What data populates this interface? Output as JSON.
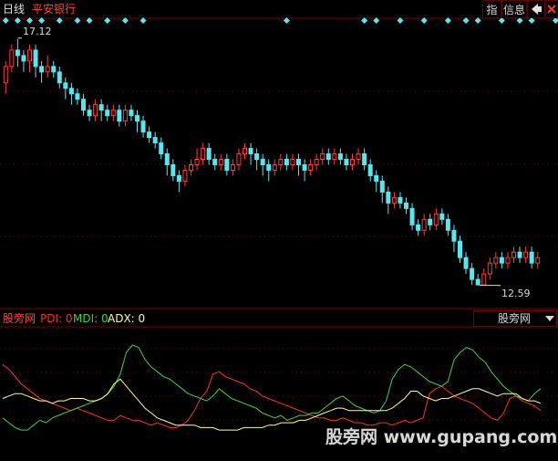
{
  "header": {
    "period": "日线",
    "stock_name": "平安银行",
    "buttons": [
      "指",
      "信息"
    ],
    "nav_icon": "arrow-left-icon",
    "close_icon": "close-icon"
  },
  "colors": {
    "up": "#ff3b3b",
    "down": "#57e7f1",
    "pdi": "#ff2b2b",
    "mdi": "#3fd23f",
    "adx": "#ffff8a",
    "marker": "#57e7f1",
    "grid": "#7a0000"
  },
  "price_labels": {
    "high": "17.12",
    "low": "12.59"
  },
  "indicator": {
    "name": "股旁网",
    "pdi": "PDI: 0",
    "mdi": "MDI: 0",
    "adx": "ADX: 0",
    "selector": "股旁网"
  },
  "watermark": "股旁网 www.gupang.com",
  "chart_data": [
    {
      "type": "candlestick",
      "title": "平安银行",
      "high_mark": 17.12,
      "low_mark": 12.59,
      "ylim": [
        12.3,
        17.4
      ],
      "candles": [
        [
          16.3,
          16.6,
          16.1,
          16.7
        ],
        [
          16.6,
          16.9,
          16.5,
          17.0
        ],
        [
          16.9,
          16.8,
          16.6,
          17.1
        ],
        [
          16.8,
          16.7,
          16.5,
          16.9
        ],
        [
          16.7,
          16.9,
          16.5,
          17.0
        ],
        [
          16.9,
          16.6,
          16.4,
          17.0
        ],
        [
          16.6,
          16.5,
          16.3,
          16.7
        ],
        [
          16.5,
          16.6,
          16.4,
          16.8
        ],
        [
          16.6,
          16.5,
          16.4,
          16.7
        ],
        [
          16.5,
          16.3,
          16.2,
          16.6
        ],
        [
          16.3,
          16.2,
          16.0,
          16.4
        ],
        [
          16.2,
          16.1,
          15.9,
          16.3
        ],
        [
          16.1,
          16.0,
          15.9,
          16.2
        ],
        [
          16.0,
          15.8,
          15.7,
          16.1
        ],
        [
          15.8,
          15.7,
          15.6,
          15.9
        ],
        [
          15.7,
          15.9,
          15.6,
          16.0
        ],
        [
          15.9,
          15.8,
          15.6,
          16.0
        ],
        [
          15.8,
          15.7,
          15.6,
          15.9
        ],
        [
          15.7,
          15.8,
          15.6,
          15.9
        ],
        [
          15.8,
          15.6,
          15.5,
          15.9
        ],
        [
          15.6,
          15.8,
          15.5,
          15.9
        ],
        [
          15.8,
          15.7,
          15.6,
          15.9
        ],
        [
          15.7,
          15.6,
          15.4,
          15.8
        ],
        [
          15.6,
          15.4,
          15.3,
          15.7
        ],
        [
          15.4,
          15.3,
          15.2,
          15.5
        ],
        [
          15.3,
          15.2,
          15.1,
          15.4
        ],
        [
          15.2,
          15.0,
          14.9,
          15.3
        ],
        [
          15.0,
          14.8,
          14.6,
          15.1
        ],
        [
          14.8,
          14.6,
          14.5,
          14.9
        ],
        [
          14.6,
          14.5,
          14.3,
          14.7
        ],
        [
          14.5,
          14.7,
          14.4,
          14.8
        ],
        [
          14.7,
          14.8,
          14.6,
          14.9
        ],
        [
          14.8,
          14.9,
          14.7,
          15.1
        ],
        [
          14.9,
          15.1,
          14.8,
          15.2
        ],
        [
          15.1,
          14.9,
          14.8,
          15.2
        ],
        [
          14.9,
          14.8,
          14.7,
          15.0
        ],
        [
          14.8,
          14.9,
          14.7,
          15.0
        ],
        [
          14.9,
          14.7,
          14.6,
          15.0
        ],
        [
          14.7,
          14.8,
          14.6,
          14.9
        ],
        [
          14.8,
          15.0,
          14.7,
          15.1
        ],
        [
          15.0,
          15.1,
          14.9,
          15.2
        ],
        [
          15.1,
          15.0,
          14.8,
          15.2
        ],
        [
          15.0,
          14.9,
          14.7,
          15.1
        ],
        [
          14.9,
          14.8,
          14.6,
          15.0
        ],
        [
          14.8,
          14.7,
          14.5,
          14.9
        ],
        [
          14.7,
          14.8,
          14.6,
          14.9
        ],
        [
          14.8,
          14.9,
          14.7,
          15.0
        ],
        [
          14.9,
          14.8,
          14.7,
          15.0
        ],
        [
          14.8,
          14.9,
          14.7,
          15.0
        ],
        [
          14.9,
          14.8,
          14.6,
          15.0
        ],
        [
          14.8,
          14.7,
          14.5,
          14.9
        ],
        [
          14.7,
          14.8,
          14.6,
          14.9
        ],
        [
          14.8,
          14.9,
          14.7,
          15.0
        ],
        [
          14.9,
          15.0,
          14.8,
          15.1
        ],
        [
          15.0,
          14.9,
          14.8,
          15.1
        ],
        [
          14.9,
          15.0,
          14.8,
          15.1
        ],
        [
          15.0,
          14.9,
          14.8,
          15.1
        ],
        [
          14.9,
          14.8,
          14.7,
          15.0
        ],
        [
          14.8,
          14.9,
          14.7,
          15.0
        ],
        [
          14.9,
          15.0,
          14.8,
          15.1
        ],
        [
          15.0,
          14.8,
          14.7,
          15.1
        ],
        [
          14.8,
          14.6,
          14.5,
          14.9
        ],
        [
          14.6,
          14.5,
          14.3,
          14.7
        ],
        [
          14.5,
          14.3,
          14.1,
          14.6
        ],
        [
          14.3,
          14.1,
          13.9,
          14.4
        ],
        [
          14.1,
          14.2,
          14.0,
          14.3
        ],
        [
          14.2,
          14.1,
          14.0,
          14.3
        ],
        [
          14.1,
          14.0,
          13.9,
          14.2
        ],
        [
          14.0,
          13.7,
          13.6,
          14.1
        ],
        [
          13.7,
          13.6,
          13.5,
          13.8
        ],
        [
          13.6,
          13.8,
          13.5,
          13.9
        ],
        [
          13.8,
          13.7,
          13.6,
          13.9
        ],
        [
          13.7,
          13.9,
          13.6,
          14.0
        ],
        [
          13.9,
          13.8,
          13.7,
          14.0
        ],
        [
          13.8,
          13.6,
          13.5,
          13.9
        ],
        [
          13.6,
          13.4,
          13.2,
          13.7
        ],
        [
          13.4,
          13.1,
          13.0,
          13.5
        ],
        [
          13.1,
          12.9,
          12.8,
          13.2
        ],
        [
          12.9,
          12.7,
          12.6,
          13.0
        ],
        [
          12.7,
          12.6,
          12.59,
          12.8
        ],
        [
          12.6,
          12.8,
          12.59,
          12.9
        ],
        [
          12.8,
          13.0,
          12.7,
          13.1
        ],
        [
          13.0,
          13.1,
          12.9,
          13.2
        ],
        [
          13.1,
          13.0,
          12.9,
          13.2
        ],
        [
          13.0,
          13.1,
          12.9,
          13.2
        ],
        [
          13.1,
          13.2,
          13.0,
          13.3
        ],
        [
          13.2,
          13.1,
          13.0,
          13.3
        ],
        [
          13.1,
          13.2,
          13.0,
          13.3
        ],
        [
          13.2,
          13.0,
          12.9,
          13.3
        ],
        [
          13.0,
          13.1,
          12.9,
          13.2
        ]
      ],
      "signals": [
        0,
        2,
        4,
        6,
        9,
        12,
        14,
        17,
        20,
        23,
        47,
        60,
        62,
        66,
        70,
        74,
        77,
        79,
        83,
        86,
        88,
        92,
        96,
        98,
        99,
        100,
        101
      ]
    },
    {
      "type": "line",
      "title": "股旁网",
      "series": [
        {
          "name": "PDI",
          "values": [
            36,
            34,
            31,
            28,
            26,
            24,
            22,
            21,
            20,
            19,
            18,
            17,
            18,
            17,
            16,
            15,
            14,
            13,
            13,
            15,
            14,
            13,
            13,
            12,
            11,
            12,
            11,
            10,
            10,
            11,
            13,
            17,
            22,
            25,
            32,
            33,
            31,
            30,
            29,
            28,
            26,
            25,
            23,
            22,
            21,
            20,
            19,
            18,
            17,
            16,
            15,
            14,
            14,
            13,
            13,
            14,
            13,
            12,
            12,
            11,
            11,
            12,
            12,
            11,
            12,
            13,
            12,
            13,
            14,
            24,
            26,
            27,
            25,
            23,
            22,
            21,
            20,
            18,
            16,
            14,
            13,
            16,
            22,
            23,
            21,
            20,
            19,
            17
          ]
        },
        {
          "name": "MDI",
          "values": [
            14,
            12,
            10,
            9,
            9,
            11,
            13,
            12,
            14,
            15,
            16,
            17,
            18,
            19,
            20,
            21,
            22,
            24,
            27,
            32,
            41,
            44,
            43,
            38,
            35,
            33,
            31,
            30,
            28,
            26,
            24,
            23,
            22,
            21,
            23,
            26,
            24,
            22,
            21,
            20,
            19,
            18,
            16,
            15,
            14,
            15,
            13,
            14,
            15,
            15,
            16,
            16,
            18,
            20,
            22,
            23,
            21,
            19,
            18,
            17,
            16,
            17,
            21,
            30,
            34,
            36,
            35,
            33,
            31,
            29,
            28,
            27,
            29,
            38,
            41,
            43,
            42,
            39,
            37,
            33,
            30,
            27,
            25,
            23,
            22,
            21,
            24,
            26
          ]
        },
        {
          "name": "ADX",
          "values": [
            22,
            23,
            24,
            24,
            23,
            22,
            21,
            21,
            20,
            21,
            21,
            22,
            22,
            22,
            21,
            21,
            22,
            24,
            28,
            30,
            27,
            24,
            21,
            18,
            16,
            14,
            13,
            12,
            11,
            11,
            11,
            11,
            10,
            10,
            10,
            9,
            9,
            9,
            9,
            10,
            10,
            10,
            10,
            11,
            11,
            12,
            12,
            12,
            13,
            13,
            14,
            15,
            16,
            17,
            18,
            18,
            17,
            17,
            17,
            17,
            17,
            17,
            17,
            18,
            20,
            22,
            25,
            25,
            23,
            22,
            21,
            22,
            22,
            23,
            24,
            25,
            26,
            26,
            25,
            24,
            23,
            24,
            24,
            24,
            22,
            21,
            21,
            20
          ]
        }
      ]
    }
  ]
}
